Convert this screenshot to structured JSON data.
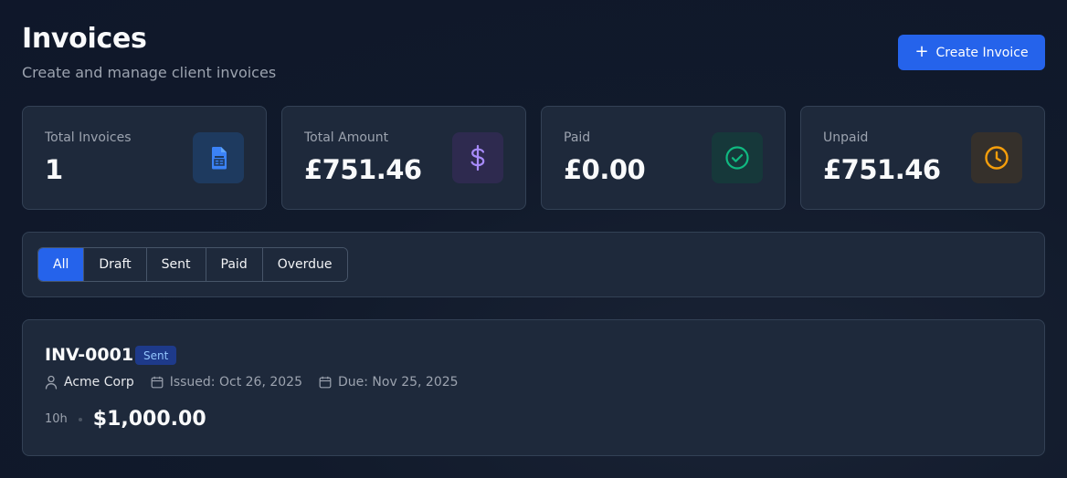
{
  "header": {
    "title": "Invoices",
    "subtitle": "Create and manage client invoices",
    "create_button": "Create Invoice"
  },
  "stats": [
    {
      "label": "Total Invoices",
      "value": "1",
      "icon": "document-icon",
      "icon_color": "#3b82f6",
      "icon_bg": "#1e3a5f"
    },
    {
      "label": "Total Amount",
      "value": "£751.46",
      "icon": "dollar-icon",
      "icon_color": "#a78bfa",
      "icon_bg": "#2e2a4f"
    },
    {
      "label": "Paid",
      "value": "£0.00",
      "icon": "check-circle-icon",
      "icon_color": "#10b981",
      "icon_bg": "#16383a"
    },
    {
      "label": "Unpaid",
      "value": "£751.46",
      "icon": "clock-icon",
      "icon_color": "#f59e0b",
      "icon_bg": "#35302b"
    }
  ],
  "filters": {
    "tabs": [
      "All",
      "Draft",
      "Sent",
      "Paid",
      "Overdue"
    ],
    "active": "All"
  },
  "invoice": {
    "number": "INV-0001",
    "status": "Sent",
    "client": "Acme Corp",
    "issued": "Issued: Oct 26, 2025",
    "due": "Due: Nov 25, 2025",
    "hours": "10h",
    "amount": "$1,000.00"
  }
}
